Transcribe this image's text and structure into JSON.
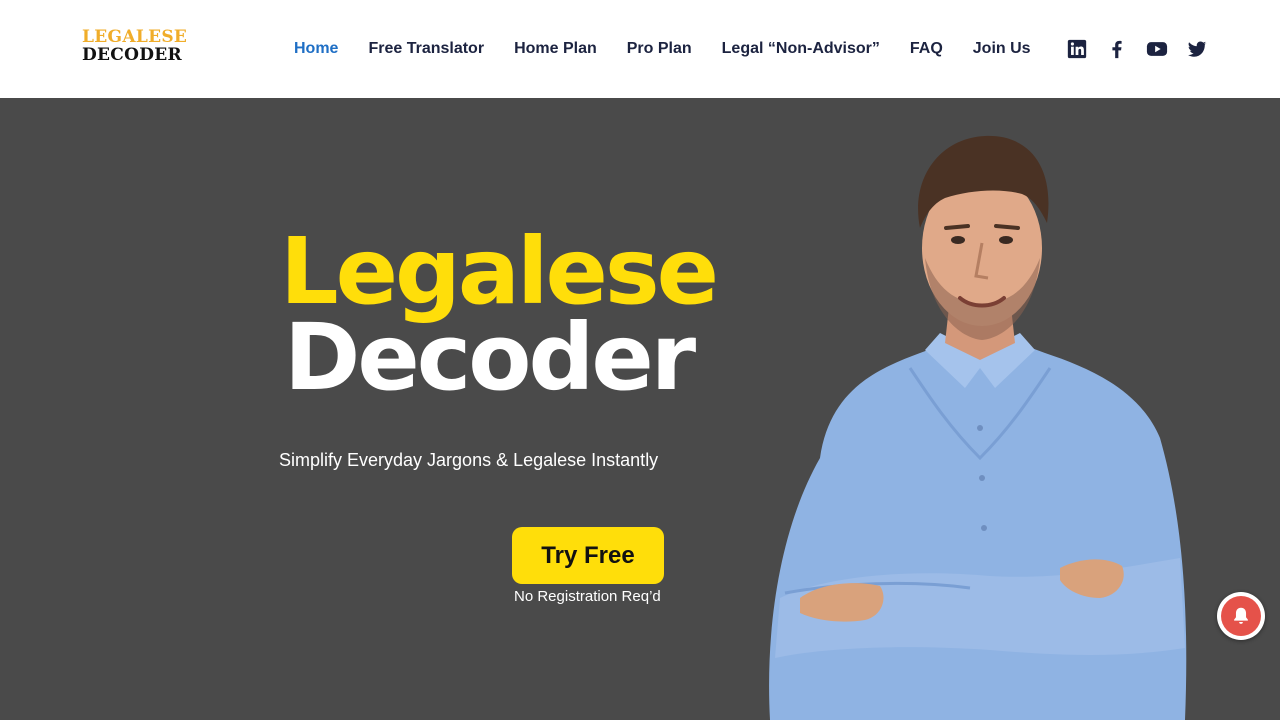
{
  "logo": {
    "line1": "LEGALESE",
    "line2": "DECODER"
  },
  "nav": {
    "items": [
      {
        "label": "Home",
        "active": true
      },
      {
        "label": "Free Translator",
        "active": false
      },
      {
        "label": "Home Plan",
        "active": false
      },
      {
        "label": "Pro Plan",
        "active": false
      },
      {
        "label": "Legal “Non-Advisor”",
        "active": false
      },
      {
        "label": "FAQ",
        "active": false
      },
      {
        "label": "Join Us",
        "active": false
      }
    ]
  },
  "social": [
    "linkedin-icon",
    "facebook-icon",
    "youtube-icon",
    "twitter-icon"
  ],
  "hero": {
    "title_line1": "Legalese",
    "title_line2": "Decoder",
    "tagline": "Simplify Everyday Jargons & Legalese Instantly",
    "cta_label": "Try Free",
    "cta_note": "No Registration Req’d"
  },
  "colors": {
    "accent_yellow": "#ffde0a",
    "nav_active": "#1f6fc5",
    "nav_text": "#1c2340",
    "hero_bg": "#4a4a4a",
    "logo_orange": "#f0ad2a",
    "notification_red": "#e5524a"
  }
}
